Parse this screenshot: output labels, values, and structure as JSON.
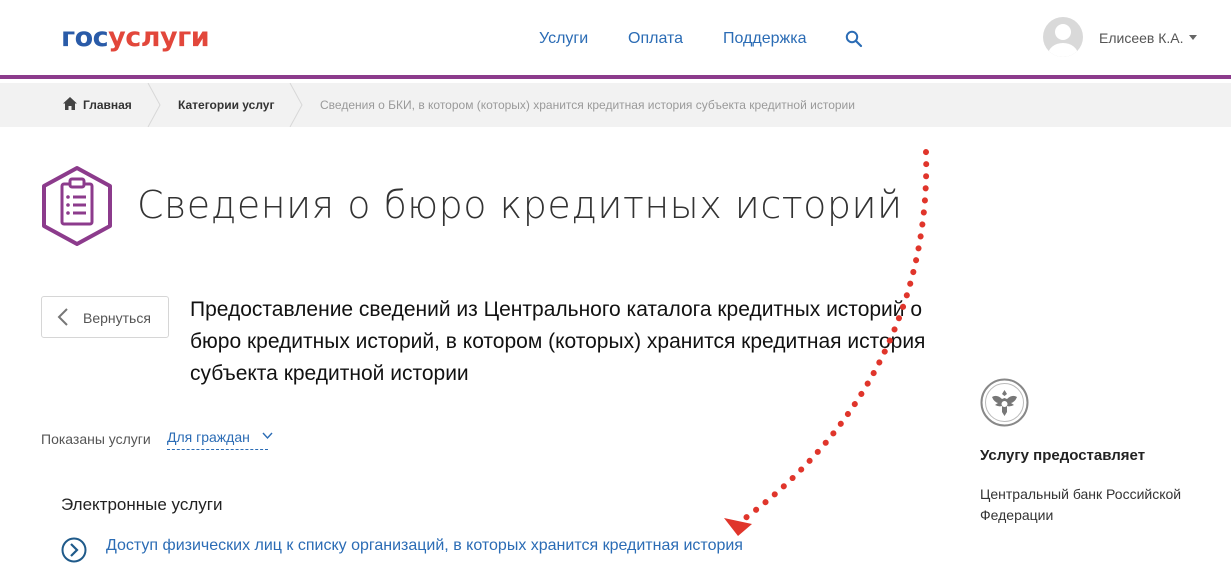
{
  "header": {
    "logo_part1": "гос",
    "logo_part2": "услуги",
    "nav": [
      "Услуги",
      "Оплата",
      "Поддержка"
    ],
    "user_name": "Елисеев К.А."
  },
  "breadcrumb": {
    "home": "Главная",
    "categories": "Категории услуг",
    "current": "Сведения о БКИ, в котором (которых) хранится кредитная история субъекта кредитной истории"
  },
  "page": {
    "title": "Сведения о бюро кредитных историй",
    "back_label": "Вернуться",
    "description": "Предоставление сведений из Центрального каталога кредитных историй о бюро кредитных историй, в котором (которых) хранится кредитная история субъекта кредитной истории",
    "shown_label": "Показаны услуги",
    "shown_value": "Для граждан",
    "section_title": "Электронные услуги",
    "service_link": "Доступ физических лиц к списку организаций, в которых хранится кредитная история"
  },
  "provider": {
    "title": "Услугу предоставляет",
    "name": "Центральный банк Российской Федерации"
  },
  "colors": {
    "accent_purple": "#8c3b8c",
    "link_blue": "#2b6cb5",
    "logo_blue": "#2a5ba8",
    "logo_red": "#e2473b",
    "annotation_red": "#e0352b"
  }
}
